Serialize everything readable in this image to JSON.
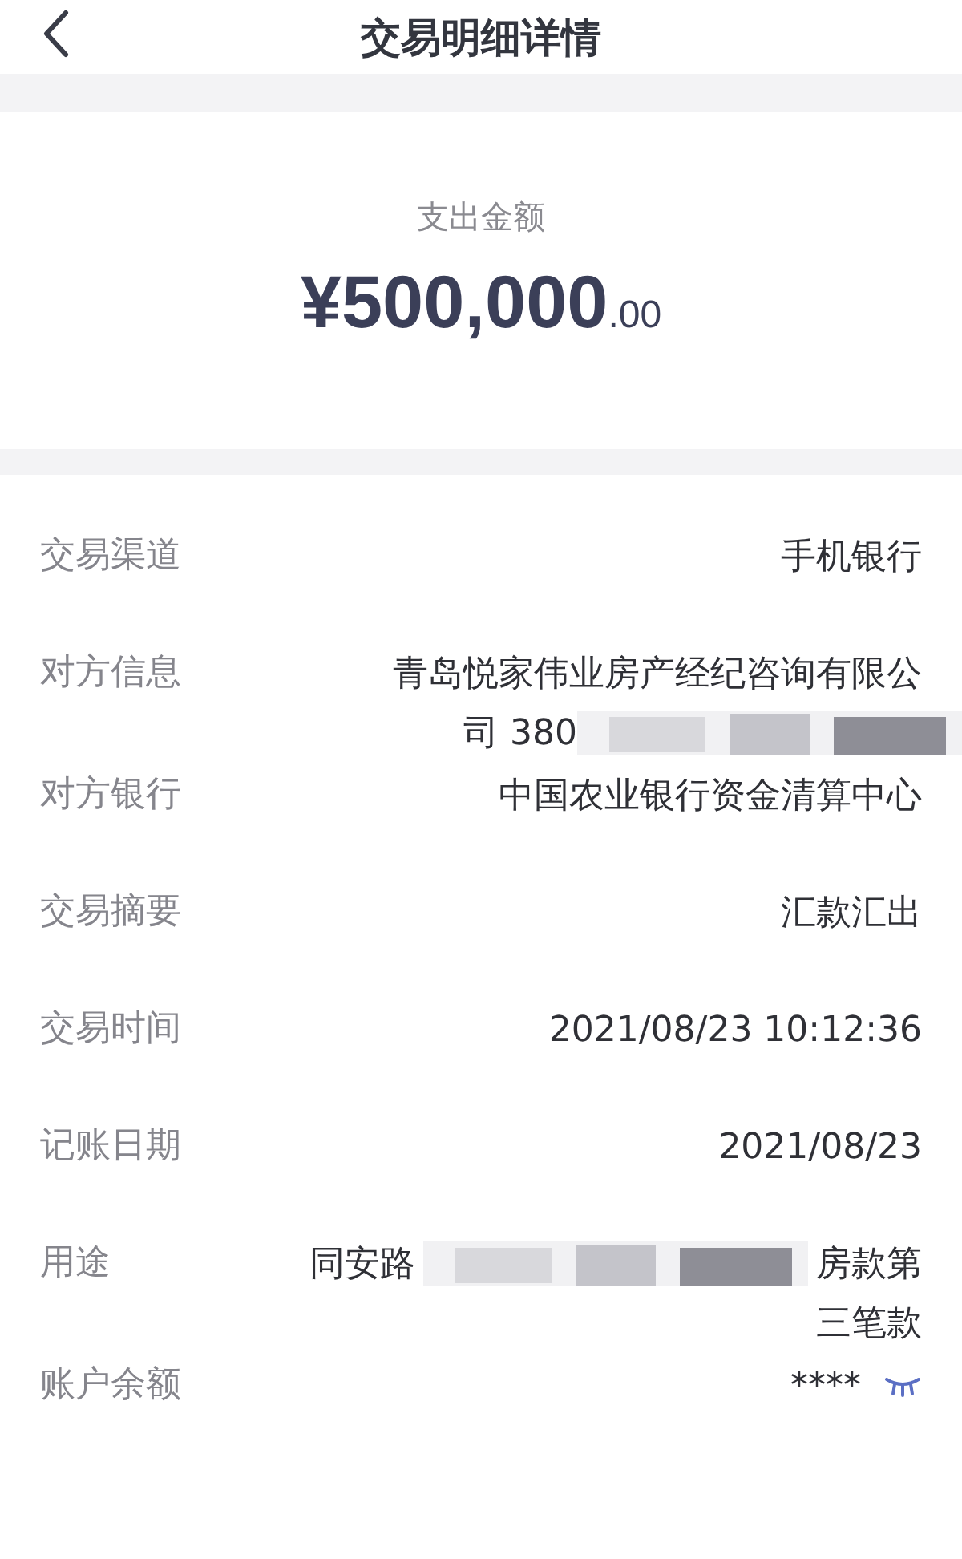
{
  "header": {
    "title": "交易明细详情"
  },
  "summary": {
    "label": "支出金额",
    "amount": "¥500,000",
    "decimals": ".00"
  },
  "details": [
    {
      "label": "交易渠道",
      "lines": [
        [
          {
            "kind": "text",
            "text": "手机银行"
          }
        ]
      ]
    },
    {
      "label": "对方信息",
      "lines": [
        [
          {
            "kind": "text",
            "text": "青岛悦家伟业房产经纪咨询有限公"
          }
        ],
        [
          {
            "kind": "text",
            "text": "司 380"
          },
          {
            "kind": "redaction"
          }
        ]
      ]
    },
    {
      "label": "对方银行",
      "lines": [
        [
          {
            "kind": "text",
            "text": "中国农业银行资金清算中心"
          }
        ]
      ]
    },
    {
      "label": "交易摘要",
      "lines": [
        [
          {
            "kind": "text",
            "text": "汇款汇出"
          }
        ]
      ]
    },
    {
      "label": "交易时间",
      "lines": [
        [
          {
            "kind": "text",
            "text": "2021/08/23 10:12:36"
          }
        ]
      ]
    },
    {
      "label": "记账日期",
      "lines": [
        [
          {
            "kind": "text",
            "text": "2021/08/23"
          }
        ]
      ]
    },
    {
      "label": "用途",
      "lines": [
        [
          {
            "kind": "text",
            "text": "同安路"
          },
          {
            "kind": "redaction"
          },
          {
            "kind": "text",
            "text": "房款第"
          }
        ],
        [
          {
            "kind": "text",
            "text": "三笔款"
          }
        ]
      ]
    },
    {
      "label": "账户余额",
      "lines": [
        [
          {
            "kind": "text",
            "text": "****"
          },
          {
            "kind": "eye"
          }
        ]
      ]
    }
  ]
}
